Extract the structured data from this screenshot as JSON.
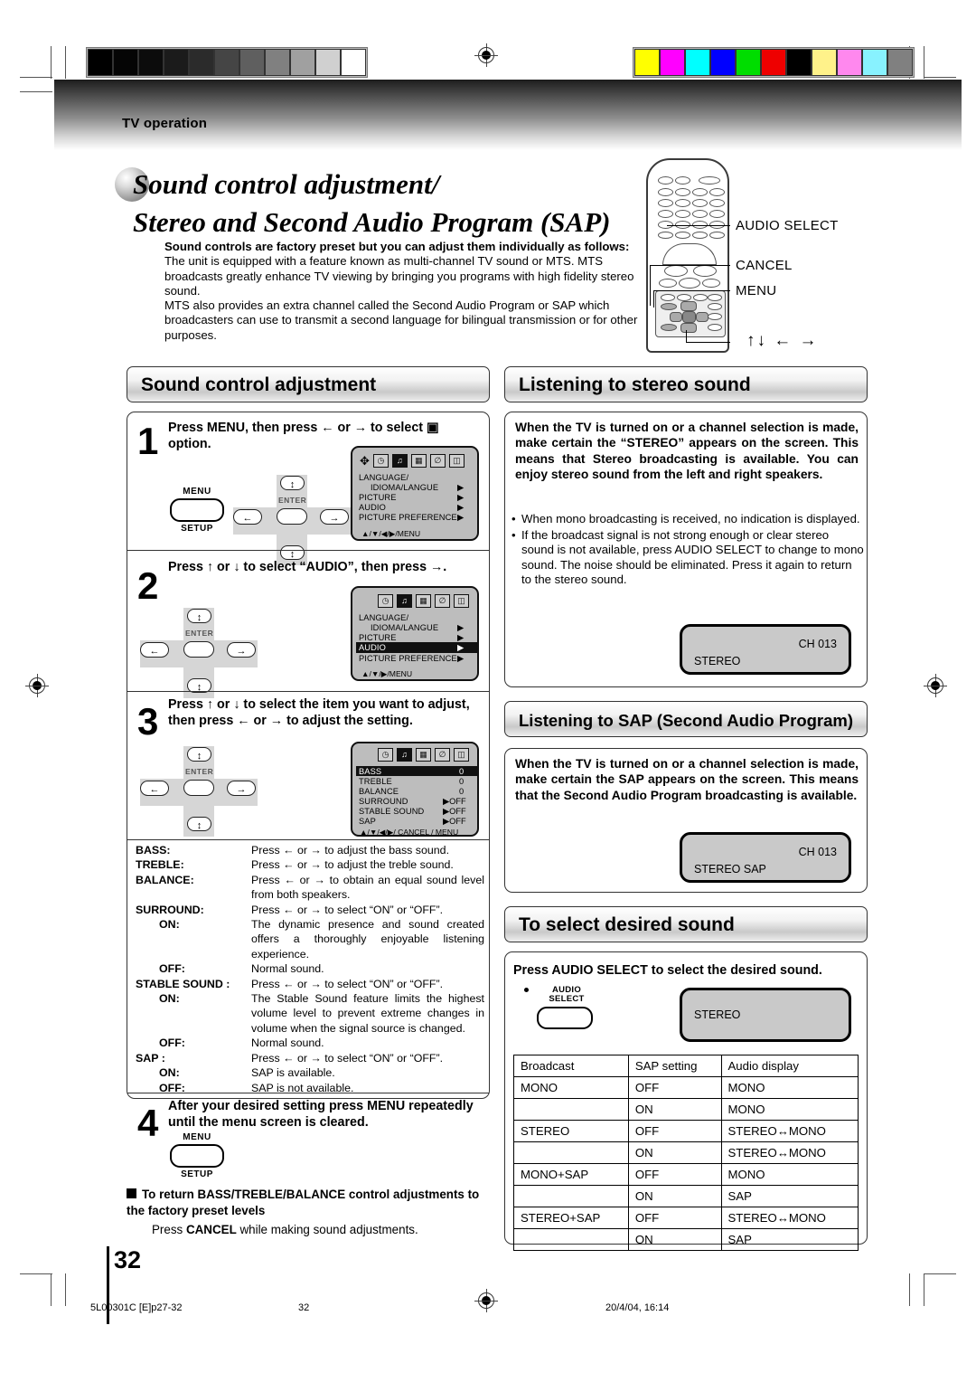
{
  "header": {
    "section_label": "TV operation"
  },
  "title": {
    "line1": "Sound control adjustment/",
    "line2": "Stereo and Second Audio Program (SAP)"
  },
  "intro": {
    "lead": "Sound controls are factory preset but you can adjust them individually as follows:",
    "p1": "The unit is equipped with a feature known as multi-channel TV sound or MTS. MTS broadcasts greatly enhance TV viewing by bringing you programs with high fidelity stereo sound.",
    "p2": "MTS also provides an extra channel called the Second Audio Program or SAP which broadcasters can use to transmit a second language for bilingual transmission or for other purposes."
  },
  "remote_callouts": {
    "audio_select": "AUDIO SELECT",
    "cancel": "CANCEL",
    "menu": "MENU",
    "arrows": "↑↓ ← →"
  },
  "sections": {
    "sound_control": "Sound control adjustment",
    "listening_stereo": "Listening to stereo sound",
    "listening_sap": "Listening to SAP (Second Audio Program)",
    "select_sound": "To select desired sound"
  },
  "steps": {
    "s1": {
      "num": "1",
      "text": "Press MENU, then press ← or → to select ▣ option."
    },
    "s2": {
      "num": "2",
      "text": "Press ↑ or ↓ to select “AUDIO”, then press →."
    },
    "s3": {
      "num": "3",
      "text": "Press ↑ or ↓ to select the item you want to adjust, then press ← or → to adjust the setting."
    },
    "s4": {
      "num": "4",
      "text": "After your desired setting press MENU repeatedly until the menu screen is cleared."
    }
  },
  "buttons": {
    "menu_top": "MENU",
    "menu_bottom": "SETUP",
    "enter": "ENTER",
    "audio_select_line1": "AUDIO",
    "audio_select_line2": "SELECT"
  },
  "osd1": {
    "items": [
      {
        "label": "LANGUAGE/",
        "value": ""
      },
      {
        "label": "IDIOMA/LANGUE",
        "value": "▶"
      },
      {
        "label": "PICTURE",
        "value": "▶"
      },
      {
        "label": "AUDIO",
        "value": "▶"
      },
      {
        "label": "PICTURE  PREFERENCE",
        "value": "▶"
      }
    ],
    "footer": "▲/▼/◀/▶/MENU"
  },
  "osd2": {
    "items": [
      {
        "label": "LANGUAGE/",
        "value": ""
      },
      {
        "label": "IDIOMA/LANGUE",
        "value": "▶"
      },
      {
        "label": "PICTURE",
        "value": "▶"
      },
      {
        "label": "AUDIO",
        "value": "▶"
      },
      {
        "label": "PICTURE  PREFERENCE",
        "value": "▶"
      }
    ],
    "highlight": "AUDIO",
    "footer": "▲/▼/▶/MENU"
  },
  "osd3": {
    "items": [
      {
        "label": "BASS",
        "value": "0"
      },
      {
        "label": "TREBLE",
        "value": "0"
      },
      {
        "label": "BALANCE",
        "value": "0"
      },
      {
        "label": "SURROUND",
        "value": "▶OFF"
      },
      {
        "label": "STABLE SOUND",
        "value": "▶OFF"
      },
      {
        "label": "SAP",
        "value": "▶OFF"
      }
    ],
    "highlight": "BASS",
    "footer": "▲/▼/◀/▶/ CANCEL / MENU"
  },
  "definitions": [
    {
      "key": "BASS:",
      "indent": false,
      "text": "Press ← or → to adjust the bass sound."
    },
    {
      "key": "TREBLE:",
      "indent": false,
      "text": "Press ← or → to adjust the treble sound."
    },
    {
      "key": "BALANCE:",
      "indent": false,
      "text": "Press ← or → to obtain an equal sound level from both speakers."
    },
    {
      "key": "SURROUND:",
      "indent": false,
      "text": "Press ← or → to select “ON” or “OFF”."
    },
    {
      "key": "ON:",
      "indent": true,
      "text": "The dynamic presence and sound created offers a thoroughly enjoyable listening experience."
    },
    {
      "key": "OFF:",
      "indent": true,
      "text": "Normal sound."
    },
    {
      "key": "STABLE SOUND :",
      "indent": false,
      "text": "Press ← or → to select “ON” or “OFF”."
    },
    {
      "key": "ON:",
      "indent": true,
      "text": "The Stable Sound feature limits the highest volume level to prevent extreme changes in volume when the signal source is changed."
    },
    {
      "key": "OFF:",
      "indent": true,
      "text": "Normal sound."
    },
    {
      "key": "SAP :",
      "indent": false,
      "text": "Press ← or → to select “ON” or “OFF”."
    },
    {
      "key": "ON:",
      "indent": true,
      "text": "SAP is available."
    },
    {
      "key": "OFF:",
      "indent": true,
      "text": "SAP is not available."
    }
  ],
  "reset_note": {
    "heading": "To return BASS/TREBLE/BALANCE control adjustments to the factory preset levels",
    "body_pre": "Press ",
    "body_bold": "CANCEL",
    "body_post": " while making sound adjustments."
  },
  "stereo": {
    "body": "When the TV is turned on or a channel selection is made, make certain the “STEREO” appears on the screen. This means that Stereo broadcasting is available. You can enjoy stereo sound from the left and right speakers.",
    "bullets": [
      "When mono broadcasting is received, no indication is displayed.",
      "If the broadcast signal is not strong enough or clear stereo sound is not available, press AUDIO SELECT to change to mono sound. The noise should be eliminated. Press it again to return to the stereo sound."
    ],
    "screen": {
      "mode": "STEREO",
      "channel": "CH 013"
    }
  },
  "sap": {
    "body": "When the TV is turned on or a channel selection is made, make certain the SAP appears on the screen. This means that the Second Audio Program broadcasting is available.",
    "screen": {
      "mode": "STEREO  SAP",
      "channel": "CH 013"
    }
  },
  "select_sound": {
    "instruction": "Press AUDIO SELECT to select the desired sound.",
    "screen": {
      "mode": "STEREO"
    },
    "table": {
      "headers": [
        "Broadcast",
        "SAP setting",
        "Audio display"
      ],
      "rows": [
        {
          "broadcast": "MONO",
          "sap": "OFF",
          "display": "MONO"
        },
        {
          "broadcast": "",
          "sap": "ON",
          "display": "MONO"
        },
        {
          "broadcast": "STEREO",
          "sap": "OFF",
          "display": "STEREO↔MONO"
        },
        {
          "broadcast": "",
          "sap": "ON",
          "display": "STEREO↔MONO"
        },
        {
          "broadcast": "MONO+SAP",
          "sap": "OFF",
          "display": "MONO"
        },
        {
          "broadcast": "",
          "sap": "ON",
          "display": "SAP"
        },
        {
          "broadcast": "STEREO+SAP",
          "sap": "OFF",
          "display": "STEREO↔MONO"
        },
        {
          "broadcast": "",
          "sap": "ON",
          "display": "SAP"
        }
      ]
    }
  },
  "page": {
    "number": "32"
  },
  "footer": {
    "file": "5L00301C [E]p27-32",
    "page": "32",
    "date": "20/4/04, 16:14"
  },
  "calibration": {
    "gray_swatches": [
      "#000000",
      "#050505",
      "#0c0c0c",
      "#1b1b1b",
      "#2b2b2b",
      "#454545",
      "#5f5f5f",
      "#808080",
      "#a0a0a0",
      "#d0d0d0",
      "#ffffff"
    ],
    "color_swatches": [
      "#ffff00",
      "#ff00ff",
      "#00ffff",
      "#0000ff",
      "#00dd00",
      "#ee0000",
      "#000000",
      "#fff28a",
      "#ff88ee",
      "#88f2ff",
      "#808080"
    ]
  }
}
